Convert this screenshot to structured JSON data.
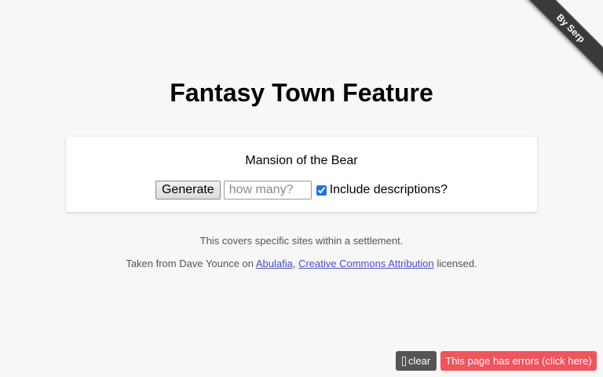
{
  "ribbon": {
    "label": "By Serp"
  },
  "title": "Fantasy Town Feature",
  "generator": {
    "result": "Mansion of the Bear",
    "generate_label": "Generate",
    "count_placeholder": "how many?",
    "count_value": "",
    "include_descriptions_label": "Include descriptions?",
    "include_descriptions_checked": true
  },
  "notes": {
    "coverage": "This covers specific sites within a settlement.",
    "credit_prefix": "Taken from Dave Younce on",
    "source_link": "Abulafia",
    "separator": ",",
    "license_link": "Creative Commons Attribution",
    "credit_suffix": "licensed."
  },
  "footer": {
    "clear_icon": "trash-icon",
    "clear_label": "clear",
    "errors_label": "This page has errors (click here)"
  },
  "colors": {
    "background": "#f7f7f7",
    "ribbon": "#3a3a3a",
    "link": "#4a4ad0",
    "clear_button": "#555555",
    "errors_button": "#f0545c"
  }
}
